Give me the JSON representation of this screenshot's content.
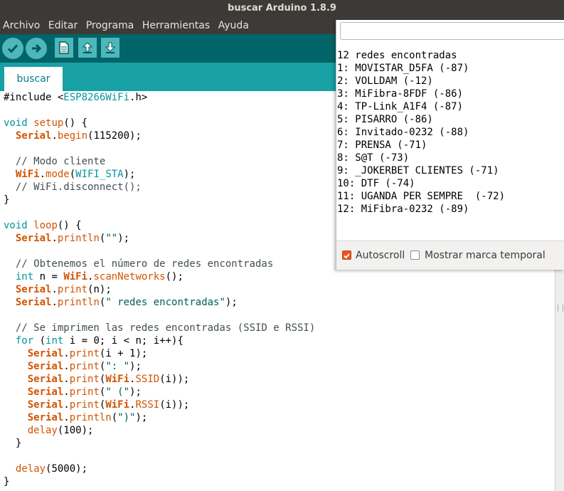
{
  "window": {
    "title": "buscar Arduino 1.8.9"
  },
  "menu": [
    "Archivo",
    "Editar",
    "Programa",
    "Herramientas",
    "Ayuda"
  ],
  "toolbar": {
    "verify_icon": "check-icon",
    "upload_icon": "arrow-right-icon",
    "new_icon": "file-icon",
    "open_icon": "arrow-up-icon",
    "save_icon": "arrow-down-icon"
  },
  "tab": {
    "label": "buscar"
  },
  "code": [
    [
      {
        "t": "#include <"
      },
      {
        "t": "ESP8266WiFi",
        "c": "k"
      },
      {
        "t": ".h>"
      }
    ],
    [],
    [
      {
        "t": "void",
        "c": "k"
      },
      {
        "t": " "
      },
      {
        "t": "setup",
        "c": "fn"
      },
      {
        "t": "() {"
      }
    ],
    [
      {
        "t": "  "
      },
      {
        "t": "Serial",
        "c": "cls"
      },
      {
        "t": "."
      },
      {
        "t": "begin",
        "c": "fn"
      },
      {
        "t": "(115200);"
      }
    ],
    [],
    [
      {
        "t": "  // Modo cliente",
        "c": "cm"
      }
    ],
    [
      {
        "t": "  "
      },
      {
        "t": "WiFi",
        "c": "cls"
      },
      {
        "t": "."
      },
      {
        "t": "mode",
        "c": "fn"
      },
      {
        "t": "("
      },
      {
        "t": "WIFI_STA",
        "c": "k"
      },
      {
        "t": ");"
      }
    ],
    [
      {
        "t": "  // WiFi.disconnect();",
        "c": "cm"
      }
    ],
    [
      {
        "t": "}"
      }
    ],
    [],
    [
      {
        "t": "void",
        "c": "k"
      },
      {
        "t": " "
      },
      {
        "t": "loop",
        "c": "fn"
      },
      {
        "t": "() {"
      }
    ],
    [
      {
        "t": "  "
      },
      {
        "t": "Serial",
        "c": "cls"
      },
      {
        "t": "."
      },
      {
        "t": "println",
        "c": "fn"
      },
      {
        "t": "("
      },
      {
        "t": "\"\"",
        "c": "st"
      },
      {
        "t": ");"
      }
    ],
    [],
    [
      {
        "t": "  // Obtenemos el número de redes encontradas",
        "c": "cm"
      }
    ],
    [
      {
        "t": "  "
      },
      {
        "t": "int",
        "c": "k"
      },
      {
        "t": " n = "
      },
      {
        "t": "WiFi",
        "c": "cls"
      },
      {
        "t": "."
      },
      {
        "t": "scanNetworks",
        "c": "fn"
      },
      {
        "t": "();"
      }
    ],
    [
      {
        "t": "  "
      },
      {
        "t": "Serial",
        "c": "cls"
      },
      {
        "t": "."
      },
      {
        "t": "print",
        "c": "fn"
      },
      {
        "t": "(n);"
      }
    ],
    [
      {
        "t": "  "
      },
      {
        "t": "Serial",
        "c": "cls"
      },
      {
        "t": "."
      },
      {
        "t": "println",
        "c": "fn"
      },
      {
        "t": "("
      },
      {
        "t": "\" redes encontradas\"",
        "c": "st"
      },
      {
        "t": ");"
      }
    ],
    [],
    [
      {
        "t": "  // Se imprimen las redes encontradas (SSID e RSSI)",
        "c": "cm"
      }
    ],
    [
      {
        "t": "  "
      },
      {
        "t": "for",
        "c": "k"
      },
      {
        "t": " ("
      },
      {
        "t": "int",
        "c": "k"
      },
      {
        "t": " i = 0; i < n; i++){"
      }
    ],
    [
      {
        "t": "    "
      },
      {
        "t": "Serial",
        "c": "cls"
      },
      {
        "t": "."
      },
      {
        "t": "print",
        "c": "fn"
      },
      {
        "t": "(i + 1);"
      }
    ],
    [
      {
        "t": "    "
      },
      {
        "t": "Serial",
        "c": "cls"
      },
      {
        "t": "."
      },
      {
        "t": "print",
        "c": "fn"
      },
      {
        "t": "("
      },
      {
        "t": "\": \"",
        "c": "st"
      },
      {
        "t": ");"
      }
    ],
    [
      {
        "t": "    "
      },
      {
        "t": "Serial",
        "c": "cls"
      },
      {
        "t": "."
      },
      {
        "t": "print",
        "c": "fn"
      },
      {
        "t": "("
      },
      {
        "t": "WiFi",
        "c": "cls"
      },
      {
        "t": "."
      },
      {
        "t": "SSID",
        "c": "fn"
      },
      {
        "t": "(i));"
      }
    ],
    [
      {
        "t": "    "
      },
      {
        "t": "Serial",
        "c": "cls"
      },
      {
        "t": "."
      },
      {
        "t": "print",
        "c": "fn"
      },
      {
        "t": "("
      },
      {
        "t": "\" (\"",
        "c": "st"
      },
      {
        "t": ");"
      }
    ],
    [
      {
        "t": "    "
      },
      {
        "t": "Serial",
        "c": "cls"
      },
      {
        "t": "."
      },
      {
        "t": "print",
        "c": "fn"
      },
      {
        "t": "("
      },
      {
        "t": "WiFi",
        "c": "cls"
      },
      {
        "t": "."
      },
      {
        "t": "RSSI",
        "c": "fn"
      },
      {
        "t": "(i));"
      }
    ],
    [
      {
        "t": "    "
      },
      {
        "t": "Serial",
        "c": "cls"
      },
      {
        "t": "."
      },
      {
        "t": "println",
        "c": "fn"
      },
      {
        "t": "("
      },
      {
        "t": "\")\"",
        "c": "st"
      },
      {
        "t": ");"
      }
    ],
    [
      {
        "t": "    "
      },
      {
        "t": "delay",
        "c": "fn"
      },
      {
        "t": "(100);"
      }
    ],
    [
      {
        "t": "  }"
      }
    ],
    [],
    [
      {
        "t": "  "
      },
      {
        "t": "delay",
        "c": "fn"
      },
      {
        "t": "(5000);"
      }
    ],
    [
      {
        "t": "}"
      }
    ]
  ],
  "serial_monitor": {
    "input_value": "",
    "lines": [
      "12 redes encontradas",
      "1: MOVISTAR_D5FA (-87)",
      "2: VOLLDAM (-12)",
      "3: MiFibra-8FDF (-86)",
      "4: TP-Link_A1F4 (-87)",
      "5: PISARRO (-86)",
      "6: Invitado-0232 (-88)",
      "7: PRENSA (-71)",
      "8: S@T (-73)",
      "9: _JOKERBET CLIENTES (-71)",
      "10: DTF (-74)",
      "11: UGANDA PER SEMPRE  (-72)",
      "12: MiFibra-0232 (-89)"
    ],
    "autoscroll_label": "Autoscroll",
    "autoscroll_checked": true,
    "timestamp_label": "Mostrar marca temporal",
    "timestamp_checked": false
  },
  "colors": {
    "toolbar": "#006468",
    "tabbar": "#17a1a5",
    "button": "#4db7bb",
    "checkbox_accent": "#e95420"
  }
}
